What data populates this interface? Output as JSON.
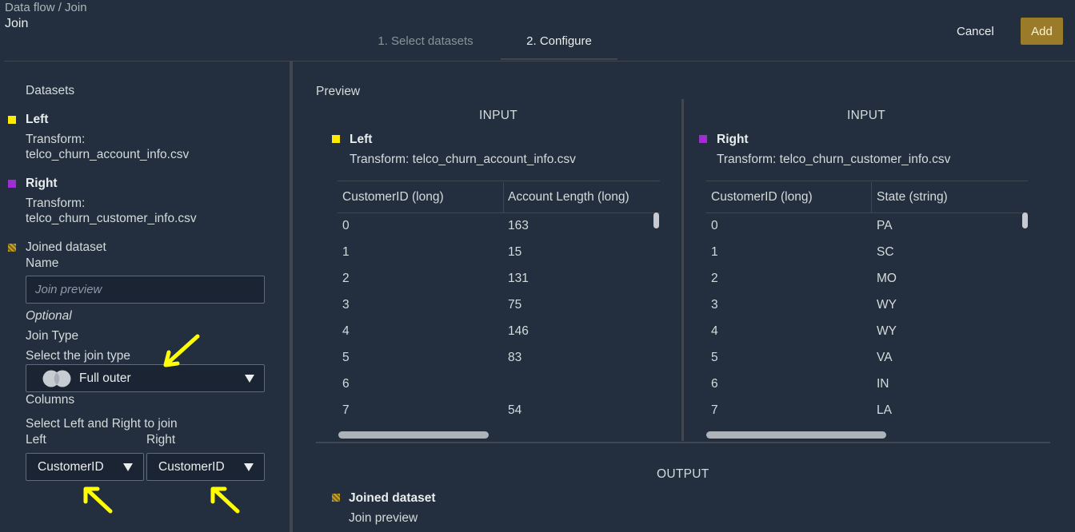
{
  "header": {
    "breadcrumb_root": "Data flow",
    "breadcrumb_sep": "/",
    "breadcrumb_current": "Join",
    "title": "Join",
    "tabs": [
      {
        "label": "1. Select datasets",
        "active": false
      },
      {
        "label": "2. Configure",
        "active": true
      }
    ],
    "cancel_label": "Cancel",
    "add_label": "Add"
  },
  "left_panel": {
    "datasets_heading": "Datasets",
    "left": {
      "label": "Left",
      "transform_label": "Transform:",
      "file": "telco_churn_account_info.csv",
      "color": "#ffeb00"
    },
    "right": {
      "label": "Right",
      "transform_label": "Transform:",
      "file": "telco_churn_customer_info.csv",
      "color": "#a02dd2"
    },
    "joined": {
      "label": "Joined dataset",
      "name_label": "Name",
      "name_placeholder": "Join preview"
    },
    "optional_label": "Optional",
    "join_type_label": "Join Type",
    "join_type_prompt": "Select the join type",
    "join_type_value": "Full outer",
    "columns_label": "Columns",
    "columns_prompt": "Select Left and Right to join",
    "left_col_label": "Left",
    "right_col_label": "Right",
    "left_col_value": "CustomerID",
    "right_col_value": "CustomerID"
  },
  "preview": {
    "heading": "Preview",
    "left_input": {
      "section_title": "INPUT",
      "label": "Left",
      "transform": "Transform: telco_churn_account_info.csv",
      "columns": [
        "CustomerID (long)",
        "Account Length (long)"
      ],
      "rows": [
        [
          "0",
          "163"
        ],
        [
          "1",
          "15"
        ],
        [
          "2",
          "131"
        ],
        [
          "3",
          "75"
        ],
        [
          "4",
          "146"
        ],
        [
          "5",
          "83"
        ],
        [
          "6",
          ""
        ],
        [
          "7",
          "54"
        ]
      ]
    },
    "right_input": {
      "section_title": "INPUT",
      "label": "Right",
      "transform": "Transform: telco_churn_customer_info.csv",
      "columns": [
        "CustomerID (long)",
        "State (string)"
      ],
      "rows": [
        [
          "0",
          "PA"
        ],
        [
          "1",
          "SC"
        ],
        [
          "2",
          "MO"
        ],
        [
          "3",
          "WY"
        ],
        [
          "4",
          "WY"
        ],
        [
          "5",
          "VA"
        ],
        [
          "6",
          "IN"
        ],
        [
          "7",
          "LA"
        ]
      ]
    },
    "output": {
      "section_title": "OUTPUT",
      "label": "Joined dataset",
      "name": "Join preview"
    }
  },
  "icons": {
    "join_type": "full-outer-join-icon",
    "dropdown": "caret-down-icon",
    "annotation": "yellow-arrow-icon"
  },
  "colors": {
    "background": "#232f3e",
    "add_button": "#9a7b2a",
    "annotation_arrow": "#ffff00"
  }
}
